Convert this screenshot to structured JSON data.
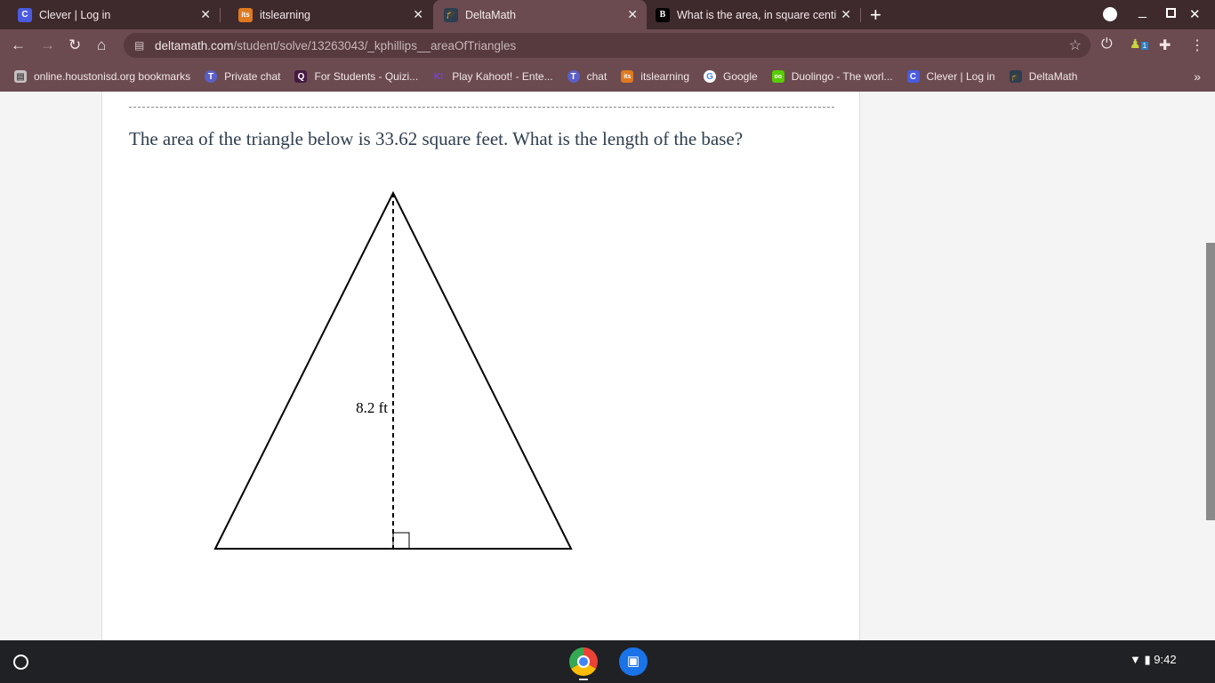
{
  "tabs": [
    {
      "label": "Clever | Log in",
      "icon": "C",
      "color": "#4a5be0"
    },
    {
      "label": "itslearning",
      "icon": "its",
      "color": "#e07a1f"
    },
    {
      "label": "DeltaMath",
      "icon": "dm",
      "color": "#2c3e50"
    },
    {
      "label": "What is the area, in square centi",
      "icon": "B",
      "color": "#000000"
    }
  ],
  "url": {
    "host": "deltamath.com",
    "path": "/student/solve/13263043/_kphillips__areaOfTriangles"
  },
  "extension_badge": "1",
  "bookmarks": [
    {
      "label": "online.houstonisd.org bookmarks",
      "icon": "folder",
      "color": "#aaa"
    },
    {
      "label": "Private chat",
      "icon": "T",
      "color": "#5b5fc7"
    },
    {
      "label": "For Students - Quizi...",
      "icon": "Q",
      "color": "#461a42"
    },
    {
      "label": "Play Kahoot! - Ente...",
      "icon": "K!",
      "color": "#46178f"
    },
    {
      "label": "chat",
      "icon": "T",
      "color": "#5b5fc7"
    },
    {
      "label": "itslearning",
      "icon": "its",
      "color": "#e07a1f"
    },
    {
      "label": "Google",
      "icon": "G",
      "color": "#ffffff"
    },
    {
      "label": "Duolingo - The worl...",
      "icon": "oo",
      "color": "#58cc02"
    },
    {
      "label": "Clever | Log in",
      "icon": "C",
      "color": "#4a5be0"
    },
    {
      "label": "DeltaMath",
      "icon": "dm",
      "color": "#2c3e50"
    }
  ],
  "question": "The area of the triangle below is 33.62 square feet. What is the length of the base?",
  "height_label": "8.2 ft",
  "clock": "9:42"
}
